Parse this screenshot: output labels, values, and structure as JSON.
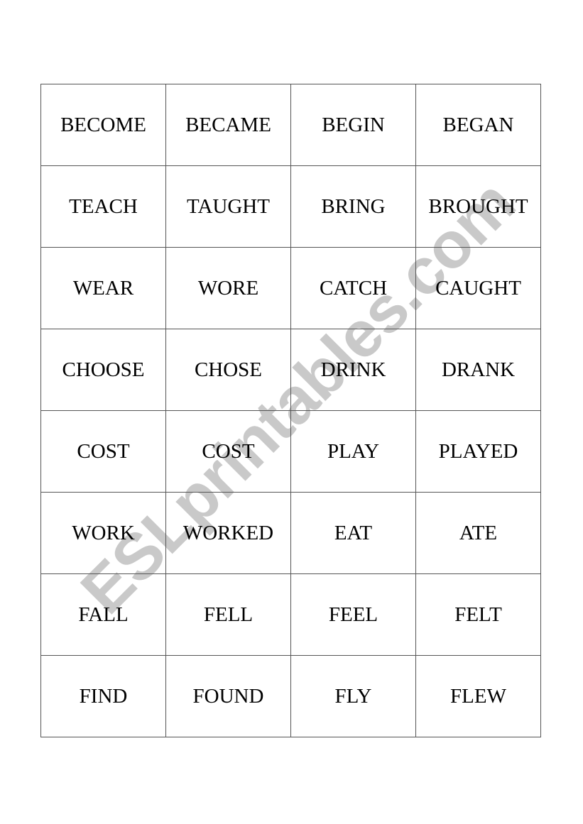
{
  "watermark": "ESLprintables.com",
  "rows": [
    [
      "BECOME",
      "BECAME",
      "BEGIN",
      "BEGAN"
    ],
    [
      "TEACH",
      "TAUGHT",
      "BRING",
      "BROUGHT"
    ],
    [
      "WEAR",
      "WORE",
      "CATCH",
      "CAUGHT"
    ],
    [
      "CHOOSE",
      "CHOSE",
      "DRINK",
      "DRANK"
    ],
    [
      "COST",
      "COST",
      "PLAY",
      "PLAYED"
    ],
    [
      "WORK",
      "WORKED",
      "EAT",
      "ATE"
    ],
    [
      "FALL",
      "FELL",
      "FEEL",
      "FELT"
    ],
    [
      "FIND",
      "FOUND",
      "FLY",
      "FLEW"
    ]
  ]
}
